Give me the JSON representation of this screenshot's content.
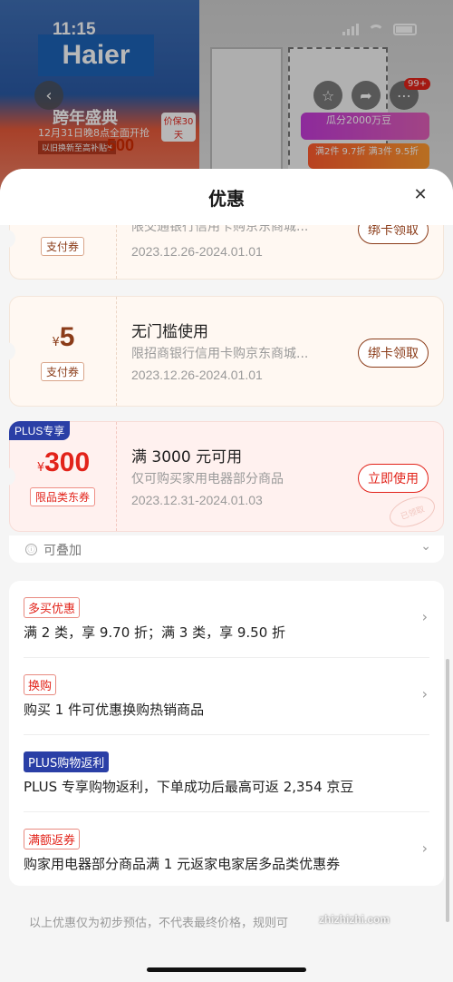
{
  "status_bar": {
    "time": "11:15"
  },
  "background": {
    "brand_logo": "Haier",
    "promo_title": "跨年盛典",
    "promo_sub": "12月31日晚8点全面开抢",
    "promo_sub2": "以旧换新至高补贴¥",
    "promo_value": "500",
    "price_tag": "价保30天",
    "promo_right": "瓜分2000万豆",
    "promo_right2": "满2件 9.7折 满3件 9.5折",
    "cart_badge": "99+"
  },
  "sheet": {
    "title": "优惠",
    "close_icon": "close-icon"
  },
  "coupons": [
    {
      "currency": "¥",
      "amount": "",
      "type": "支付券",
      "title": "",
      "desc": "限交通银行信用卡购京东商城...",
      "date": "2023.12.26-2024.01.01",
      "button": "绑卡领取"
    },
    {
      "currency": "¥",
      "amount": "5",
      "type": "支付券",
      "title": "无门槛使用",
      "desc": "限招商银行信用卡购京东商城...",
      "date": "2023.12.26-2024.01.01",
      "button": "绑卡领取"
    },
    {
      "plus_tag": "PLUS专享",
      "currency": "¥",
      "amount": "300",
      "type": "限品类东券",
      "title": "满 3000 元可用",
      "desc": "仅可购买家用电器部分商品",
      "date": "2023.12.31-2024.01.03",
      "button": "立即使用",
      "stamp": "已领取"
    }
  ],
  "stack": {
    "icon": "stack-icon",
    "label": "可叠加"
  },
  "promotions": [
    {
      "tag": "多买优惠",
      "desc": "满 2 类，享 9.70 折；满 3 类，享 9.50 折"
    },
    {
      "tag": "换购",
      "desc": "购买 1 件可优惠换购热销商品"
    },
    {
      "tag": "PLUS购物返利",
      "desc": "PLUS 专享购物返利，下单成功后最高可返 2,354 京豆"
    },
    {
      "tag": "满额返券",
      "desc": "购家用电器部分商品满 1 元返家电家居多品类优惠券"
    }
  ],
  "footnote": "以上优惠仅为初步预估，不代表最终价格，规则可",
  "watermark": "zhizhizhi.com",
  "colors": {
    "accent": "#e2231a",
    "coupon_brown": "#8b3c19",
    "plus_blue": "#2a3fa6"
  }
}
